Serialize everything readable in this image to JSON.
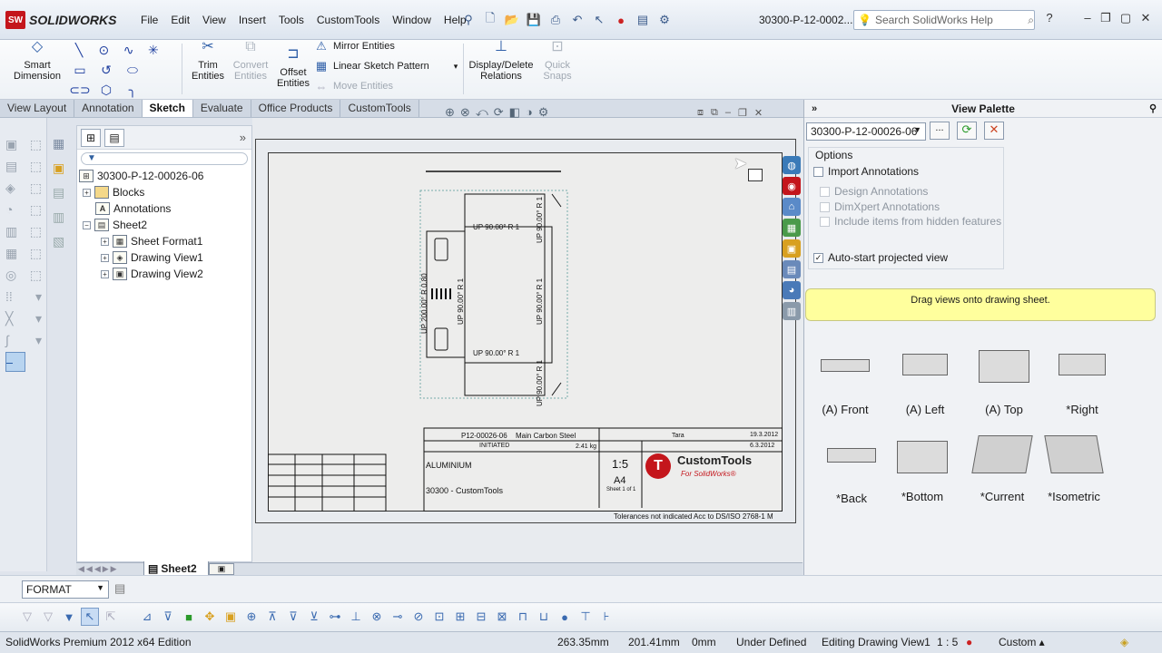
{
  "app": {
    "logo_text": "SOLIDWORKS",
    "logo_badge": "SW"
  },
  "menu": [
    "File",
    "Edit",
    "View",
    "Insert",
    "Tools",
    "CustomTools",
    "Window",
    "Help"
  ],
  "document_title": "30300-P-12-0002...",
  "search": {
    "placeholder": "Search SolidWorks Help"
  },
  "commands": {
    "smart_dimension": "Smart Dimension",
    "trim": "Trim Entities",
    "convert": "Convert Entities",
    "offset": "Offset Entities",
    "mirror": "Mirror Entities",
    "linear_pattern": "Linear Sketch Pattern",
    "move": "Move Entities",
    "display_delete": "Display/Delete Relations",
    "quick_snaps": "Quick Snaps"
  },
  "tabs": [
    "View Layout",
    "Annotation",
    "Sketch",
    "Evaluate",
    "Office Products",
    "CustomTools"
  ],
  "active_tab": "Sketch",
  "tree": {
    "root": "30300-P-12-00026-06",
    "items": [
      "Blocks",
      "Annotations",
      "Sheet2",
      "Sheet Format1",
      "Drawing View1",
      "Drawing View2"
    ]
  },
  "sheet_tab": "Sheet2",
  "drawing": {
    "labels": [
      "UP 90.00° R 1",
      "UP 90.00° R 1",
      "UP 90.00° R 1",
      "UP 200.00° R 0.80",
      "UP 90.00° R 1",
      "UP 90.00° R 1",
      "UP 90.00° R 1"
    ],
    "title_block": {
      "drawing_no": "P12-00026-06",
      "material_label": "Main Carbon Steel",
      "status": "INITIATED",
      "weight": "2.41 kg",
      "material": "ALUMINIUM",
      "scale": "1:5",
      "paper": "A4",
      "sheet": "Sheet 1 of 1",
      "title": "30300 - CustomTools",
      "brand": "CustomTools",
      "brand_sub": "For SolidWorks®",
      "date1": "19.3.2012",
      "date2": "6.3.2012",
      "approved": "Tara",
      "tolerances": "Tolerances not indicated Acc to DS/ISO 2768-1 M"
    }
  },
  "palette": {
    "title": "View Palette",
    "doc": "30300-P-12-00026-06",
    "options_label": "Options",
    "import_annotations": "Import Annotations",
    "design_annotations": "Design Annotations",
    "dimxpert": "DimXpert Annotations",
    "hidden": "Include items from hidden features",
    "autostart": "Auto-start projected view",
    "message": "Drag views onto drawing sheet.",
    "views": [
      "(A) Front",
      "(A) Left",
      "(A) Top",
      "*Right",
      "*Back",
      "*Bottom",
      "*Current",
      "*Isometric"
    ]
  },
  "format": {
    "value": "FORMAT"
  },
  "status": {
    "edition": "SolidWorks Premium 2012 x64 Edition",
    "x": "263.35mm",
    "y": "201.41mm",
    "z": "0mm",
    "state": "Under Defined",
    "editing": "Editing Drawing View1",
    "scale": "1 : 5",
    "units": "Custom"
  }
}
